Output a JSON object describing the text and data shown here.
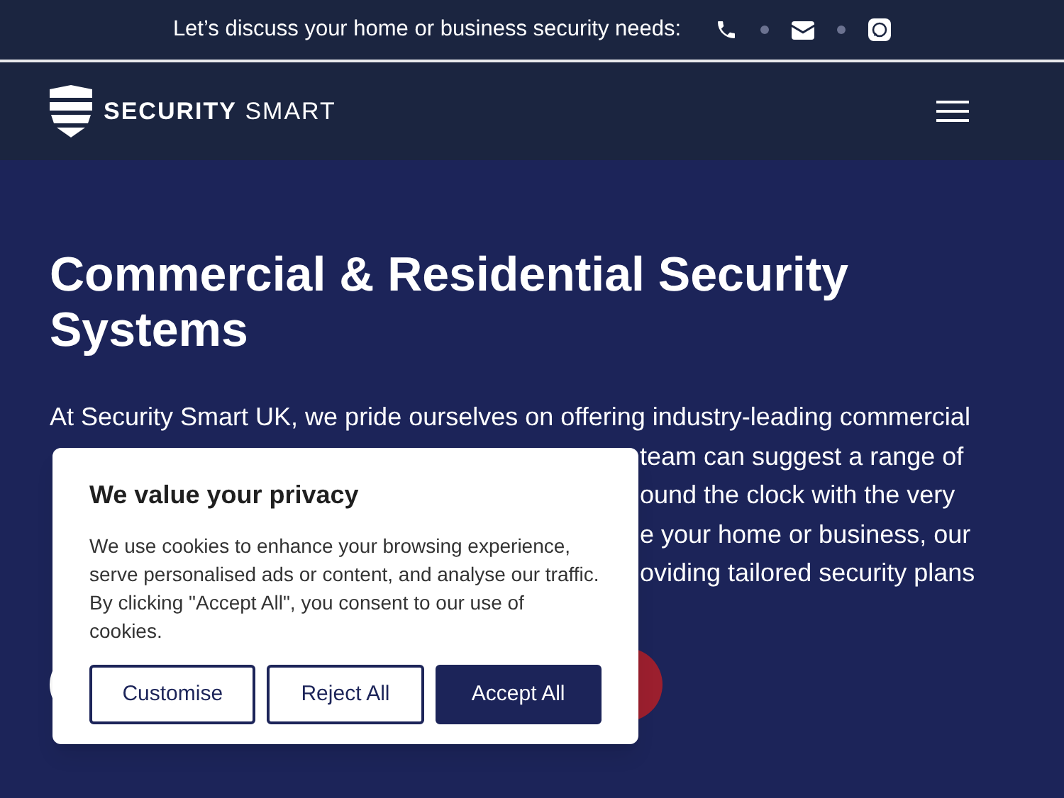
{
  "top_bar": {
    "text": "Let’s discuss your home or business security needs:"
  },
  "header": {
    "logo_bold": "SECURITY",
    "logo_light": "SMART"
  },
  "hero": {
    "title": "Commercial & Residential Security Systems",
    "paragraph_lines": [
      "At Security Smart UK, we pride ourselves on offering industry-leading commercial",
      "team can suggest a range of",
      "ound the clock with the very",
      "e your home or business, our",
      "oviding tailored security plans"
    ]
  },
  "cookie_banner": {
    "title": "We value your privacy",
    "text": "We use cookies to enhance your browsing experience, serve personalised ads or content, and analyse our traffic. By clicking \"Accept All\", you consent to our use of cookies.",
    "buttons": [
      {
        "label": "Customise",
        "kind": "outline"
      },
      {
        "label": "Reject All",
        "kind": "outline"
      },
      {
        "label": "Accept All",
        "kind": "filled"
      }
    ]
  }
}
